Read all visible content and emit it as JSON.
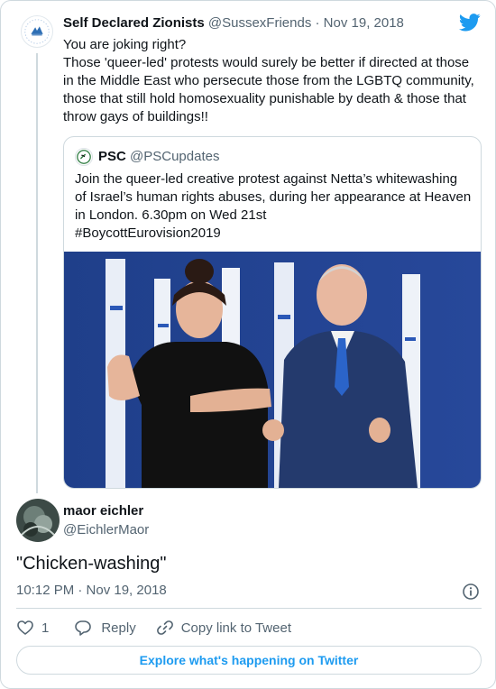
{
  "parent_tweet": {
    "author_name": "Self Declared Zionists",
    "author_handle": "@SussexFriends",
    "separator": "·",
    "date": "Nov 19, 2018",
    "text": "You are joking right?\nThose 'queer-led' protests would surely be better if directed at those in the Middle East who persecute those from the LGBTQ community, those that still hold homosexuality punishable by death & those that throw gays of buildings!!"
  },
  "quoted_tweet": {
    "author_name": "PSC",
    "author_handle": "@PSCupdates",
    "text": "Join the queer-led creative protest against Netta’s whitewashing of Israel’s human rights abuses, during her appearance at Heaven in London.  6.30pm on Wed 21st\n#BoycottEurovision2019"
  },
  "main_tweet": {
    "author_name": "maor eichler",
    "author_handle": "@EichlerMaor",
    "text": "\"Chicken-washing\"",
    "time": "10:12 PM · Nov 19, 2018"
  },
  "actions": {
    "like_count": "1",
    "reply_label": "Reply",
    "copy_link_label": "Copy link to Tweet"
  },
  "footer": {
    "explore_label": "Explore what's happening on Twitter"
  },
  "icons": {
    "brand": "twitter-bird-icon",
    "info": "info-icon",
    "like": "heart-icon",
    "reply": "speech-bubble-icon",
    "copy_link": "link-icon"
  },
  "colors": {
    "brand_blue": "#1d9bf0",
    "text_primary": "#0f1419",
    "text_secondary": "#536471",
    "border": "#cfd9de"
  }
}
